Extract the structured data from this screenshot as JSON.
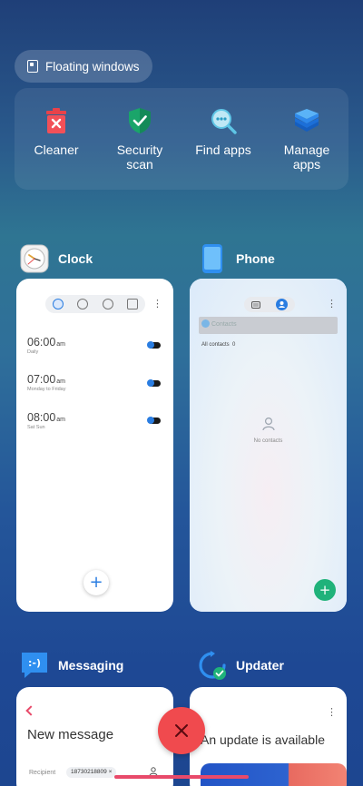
{
  "floating_windows": {
    "label": "Floating windows"
  },
  "tools": [
    {
      "label": "Cleaner",
      "icon": "trash-icon"
    },
    {
      "label": "Security\nscan",
      "icon": "shield-check-icon"
    },
    {
      "label": "Find apps",
      "icon": "search-icon"
    },
    {
      "label": "Manage\napps",
      "icon": "layers-icon"
    }
  ],
  "apps": {
    "clock": {
      "name": "Clock",
      "alarms": [
        {
          "time": "06:00",
          "ampm": "am",
          "repeat": "Daily"
        },
        {
          "time": "07:00",
          "ampm": "am",
          "repeat": "Monday to Friday"
        },
        {
          "time": "08:00",
          "ampm": "am",
          "repeat": "Sat Sun"
        }
      ],
      "add": "+"
    },
    "phone": {
      "name": "Phone",
      "search_placeholder": "Contacts",
      "filter": "All contacts",
      "filter_count": "0",
      "empty": "No contacts",
      "add": "+"
    },
    "messaging": {
      "name": "Messaging",
      "title": "New message",
      "recipient_label": "Recipient",
      "recipient_value": "18730218809 ×"
    },
    "updater": {
      "name": "Updater",
      "title": "An update is available"
    }
  },
  "colors": {
    "close": "#f04a4e",
    "accent_blue": "#2a7de1",
    "green": "#1fb27a"
  }
}
